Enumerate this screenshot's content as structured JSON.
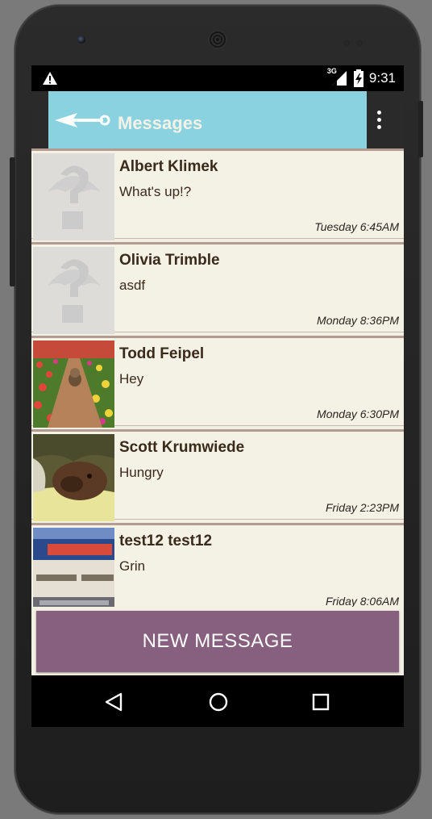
{
  "status_bar": {
    "network_label": "3G",
    "time": "9:31",
    "icons": [
      "warning-icon",
      "signal-icon",
      "battery-icon"
    ]
  },
  "app_bar": {
    "title": "Messages",
    "color": "#8ad2df",
    "back_icon": "back-arrow-icon",
    "menu_icon": "overflow-menu-icon"
  },
  "conversations": [
    {
      "name": "Albert Klimek",
      "message": "What's up!?",
      "time": "Tuesday 6:45AM",
      "avatar": "placeholder-avatar"
    },
    {
      "name": "Olivia Trimble",
      "message": "asdf",
      "time": "Monday 8:36PM",
      "avatar": "placeholder-avatar"
    },
    {
      "name": "Todd Feipel",
      "message": "Hey",
      "time": "Monday 6:30PM",
      "avatar": "photo-tulips-dog"
    },
    {
      "name": "Scott Krumwiede",
      "message": "Hungry",
      "time": "Friday 2:23PM",
      "avatar": "photo-dog-blanket"
    },
    {
      "name": "test12 test12",
      "message": "Grin",
      "time": "Friday 8:06AM",
      "avatar": "photo-storefront"
    }
  ],
  "new_message_button": {
    "label": "NEW MESSAGE",
    "color": "#86607e"
  },
  "nav_bar": {
    "icons": [
      "back-triangle-icon",
      "home-circle-icon",
      "recents-square-icon"
    ]
  }
}
